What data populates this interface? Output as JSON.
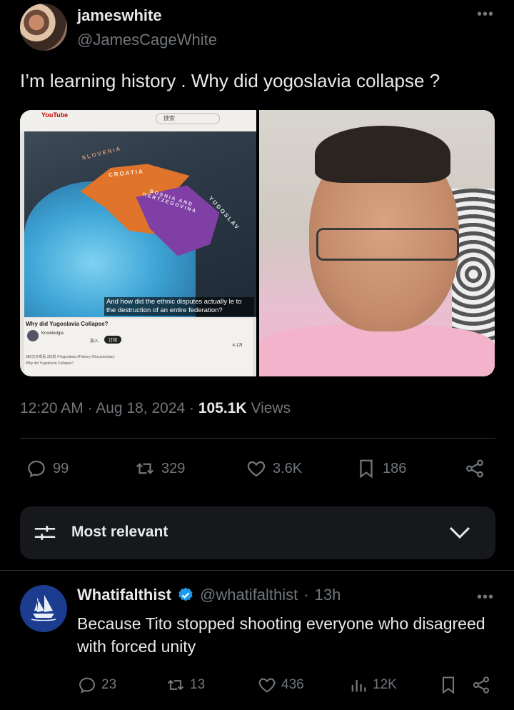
{
  "tweet": {
    "display_name": "jameswhite",
    "handle": "@JamesCageWhite",
    "more_label": "•••",
    "text": "I’m learning history . Why did yogoslavia collapse ?",
    "media": {
      "left_image": {
        "yt_logo": "YouTube",
        "search_text": "搜索",
        "labels": {
          "slovenia": "SLOVENIA",
          "croatia": "CROATIA",
          "bosnia": "BOSNIA AND HERTZEGOVINA",
          "yugoslav": "YUGOSLAV"
        },
        "caption": "And how did the ethnic disputes actually le to the destruction of an entire federation?",
        "video_title": "Why did Yugoslavia Collapse?",
        "channel": "Knowledgia",
        "join": "加入",
        "subscribe": "订阅",
        "likes": "4.1万",
        "small_meta": "380万次观看 3年前 #Yugoslavia #History #Documentary",
        "small_title": "Why did Yugoslavia Collapse?"
      }
    },
    "time": "12:20 AM",
    "date": "Aug 18, 2024",
    "views_count": "105.1K",
    "views_label": "Views",
    "actions": {
      "replies": "99",
      "retweets": "329",
      "likes": "3.6K",
      "bookmarks": "186"
    }
  },
  "sort": {
    "label": "Most relevant"
  },
  "reply": {
    "display_name": "Whatifalthist",
    "handle": "@whatifalthist",
    "time": "13h",
    "more_label": "•••",
    "text": "Because Tito stopped shooting everyone who disagreed with forced unity",
    "actions": {
      "replies": "23",
      "retweets": "13",
      "likes": "436",
      "views": "12K"
    }
  },
  "colors": {
    "background": "#000000",
    "text_primary": "#e7e9ea",
    "text_secondary": "#71767b",
    "verified_blue": "#1d9bf0",
    "sort_bg": "#16181c"
  },
  "icons": {
    "reply": "reply-icon",
    "retweet": "retweet-icon",
    "like": "heart-icon",
    "bookmark": "bookmark-icon",
    "share": "share-icon",
    "views": "views-icon",
    "sort": "sliders-icon",
    "chevron": "chevron-down-icon",
    "verified": "verified-badge-icon"
  }
}
